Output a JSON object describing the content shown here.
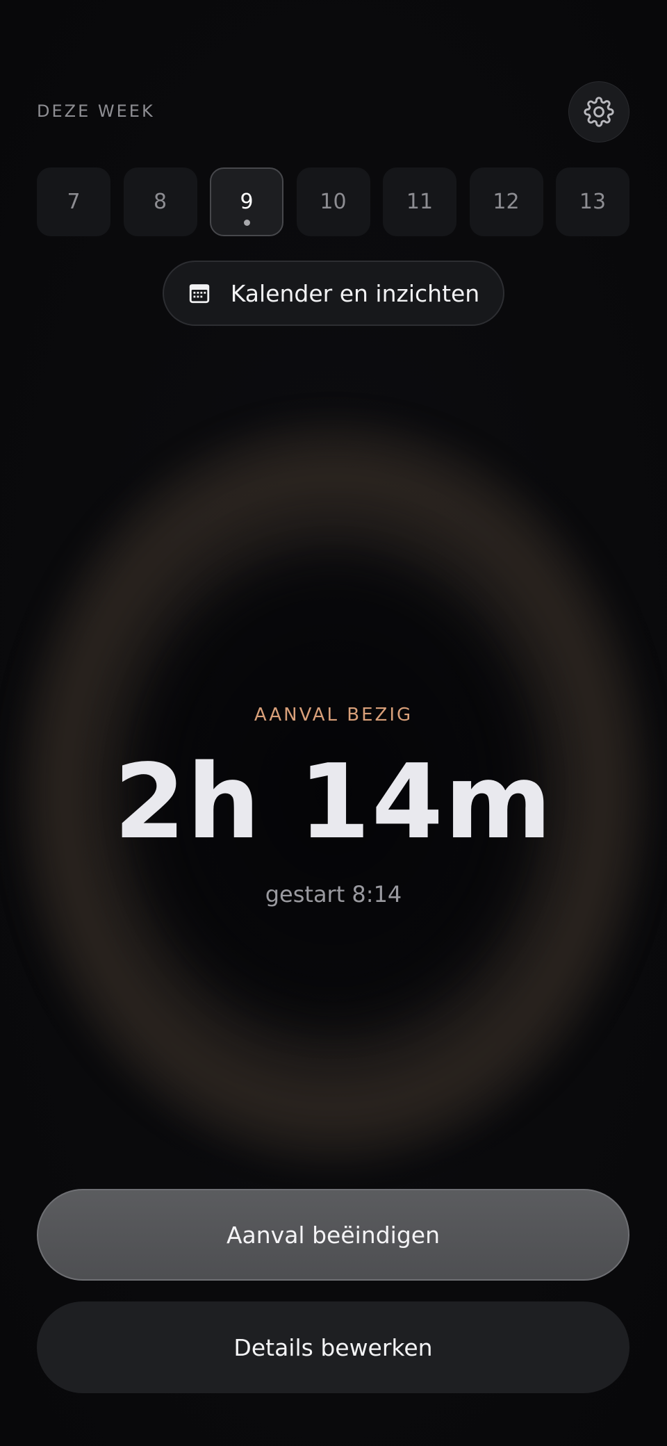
{
  "header": {
    "week_label": "DEZE WEEK",
    "settings_icon": "gear-icon"
  },
  "days": [
    {
      "label": "7",
      "selected": false
    },
    {
      "label": "8",
      "selected": false
    },
    {
      "label": "9",
      "selected": true
    },
    {
      "label": "10",
      "selected": false
    },
    {
      "label": "11",
      "selected": false
    },
    {
      "label": "12",
      "selected": false
    },
    {
      "label": "13",
      "selected": false
    }
  ],
  "calendar_button": {
    "label": "Kalender en inzichten",
    "icon": "calendar-icon"
  },
  "attack": {
    "status": "AANVAL BEZIG",
    "duration": "2h 14m",
    "started": "gestart 8:14"
  },
  "actions": {
    "end_label": "Aanval beëindigen",
    "edit_label": "Details bewerken"
  },
  "colors": {
    "accent": "#d9a07a",
    "background": "#0b0b0d"
  }
}
